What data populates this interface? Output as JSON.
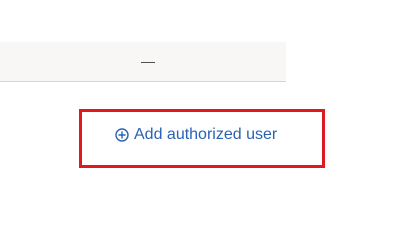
{
  "table": {
    "row": {
      "empty_value": "—"
    }
  },
  "actions": {
    "add_authorized_user_label": "Add authorized user",
    "add_icon": "plus-circle-icon"
  },
  "colors": {
    "link": "#2a62b5",
    "highlight": "#e0181f",
    "row_background": "#f8f7f6"
  }
}
